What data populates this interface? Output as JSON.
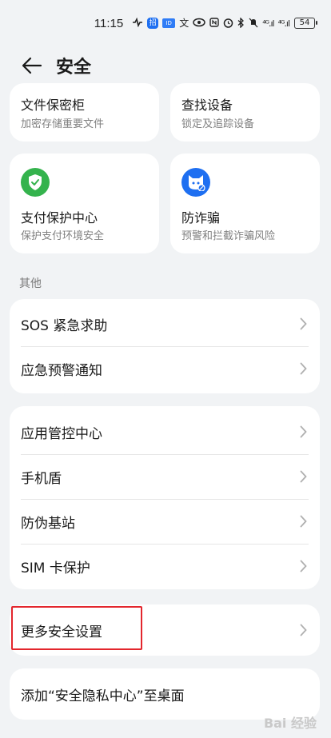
{
  "status_bar": {
    "time": "11:15",
    "app_icon_1": "招",
    "app_icon_2": "文",
    "signal_1": "⁴ᴳ.ıl",
    "signal_2": "⁴ᴳ.ıl",
    "battery": "54",
    "icons": [
      "heart-rate-icon",
      "app-icon",
      "eye-icon",
      "nfc-icon",
      "alarm-icon",
      "bluetooth-icon",
      "mute-icon",
      "signal-icon",
      "signal-icon",
      "battery-icon"
    ]
  },
  "header": {
    "title": "安全"
  },
  "cards": [
    {
      "title": "文件保密柜",
      "subtitle": "加密存储重要文件"
    },
    {
      "title": "查找设备",
      "subtitle": "锁定及追踪设备"
    },
    {
      "title": "支付保护中心",
      "subtitle": "保护支付环境安全",
      "icon": "shield-check-icon",
      "icon_color": "#34b34d"
    },
    {
      "title": "防诈骗",
      "subtitle": "预警和拦截诈骗风险",
      "icon": "anti-fraud-icon",
      "icon_color": "#1e6ff1"
    }
  ],
  "section_other": "其他",
  "group1": [
    "SOS 紧急求助",
    "应急预警通知"
  ],
  "group2": [
    "应用管控中心",
    "手机盾",
    "防伪基站",
    "SIM 卡保护"
  ],
  "group3": [
    "更多安全设置"
  ],
  "group4": [
    "添加“安全隐私中心”至桌面"
  ],
  "watermark": "Bai 经验"
}
